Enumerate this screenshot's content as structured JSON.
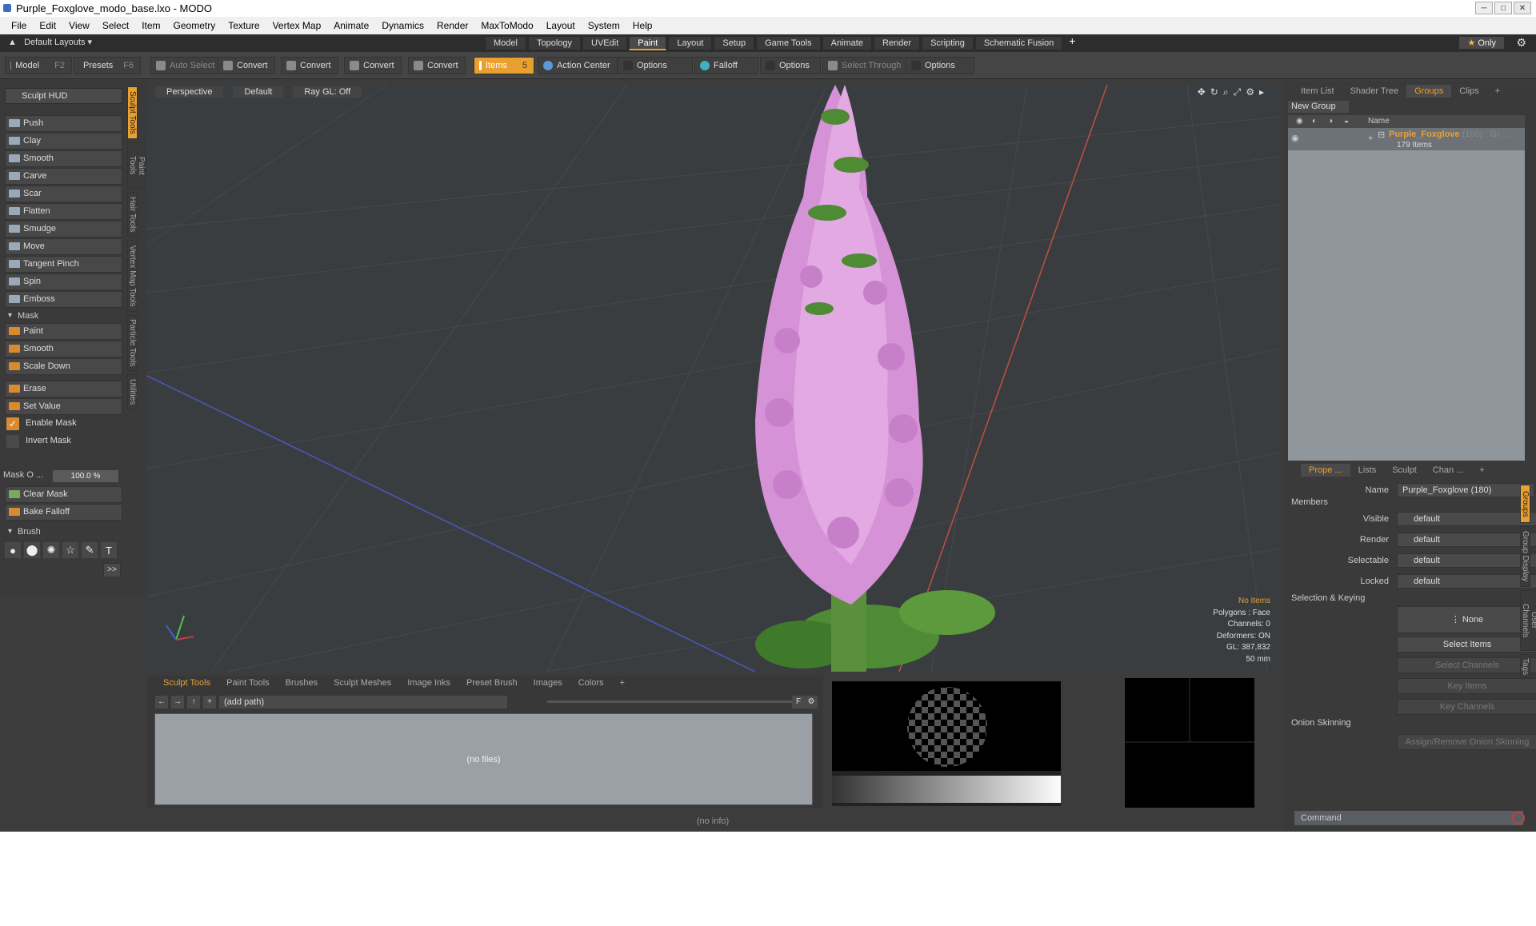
{
  "title": "Purple_Foxglove_modo_base.lxo - MODO",
  "window_buttons": [
    "─",
    "□",
    "✕"
  ],
  "menu": [
    "File",
    "Edit",
    "View",
    "Select",
    "Item",
    "Geometry",
    "Texture",
    "Vertex Map",
    "Animate",
    "Dynamics",
    "Render",
    "MaxToModo",
    "Layout",
    "System",
    "Help"
  ],
  "layout_dropdown": "Default Layouts",
  "layout_tabs": [
    "Model",
    "Topology",
    "UVEdit",
    "Paint",
    "Layout",
    "Setup",
    "Game Tools",
    "Animate",
    "Render",
    "Scripting",
    "Schematic Fusion"
  ],
  "layout_plus": "+",
  "only_label": "Only",
  "toolbar": {
    "model": "Model",
    "model_key": "F2",
    "presets": "Presets",
    "presets_key": "F6",
    "auto_select": "Auto Select",
    "convert1": "Convert",
    "convert2": "Convert",
    "convert3": "Convert",
    "convert4": "Convert",
    "items": "Items",
    "items_key": "5",
    "action_center": "Action Center",
    "options1": "Options",
    "falloff": "Falloff",
    "options2": "Options",
    "select_through": "Select Through",
    "options3": "Options"
  },
  "sculpt": {
    "hud": "Sculpt HUD",
    "tools": [
      "Push",
      "Clay",
      "Smooth",
      "Carve",
      "Scar",
      "Flatten",
      "Smudge",
      "Move",
      "Tangent Pinch",
      "Spin",
      "Emboss"
    ],
    "mask_section": "Mask",
    "mask_tools": [
      "Paint",
      "Smooth",
      "Scale Down"
    ],
    "erase": "Erase",
    "set_value": "Set Value",
    "enable_mask": "Enable Mask",
    "invert_mask": "Invert Mask",
    "mask_opacity_label": "Mask O ...",
    "mask_opacity_value": "100.0 %",
    "clear_mask": "Clear Mask",
    "bake_falloff": "Bake Falloff",
    "brush_section": "Brush",
    "more": ">>"
  },
  "vtabs": [
    "Sculpt Tools",
    "Paint Tools",
    "Hair Tools",
    "Vertex Map Tools",
    "Particle Tools",
    "Utilities"
  ],
  "viewport": {
    "view": "Perspective",
    "style": "Default",
    "raygl": "Ray GL: Off",
    "info": [
      "No Items",
      "Polygons : Face",
      "Channels: 0",
      "Deformers: ON",
      "GL: 387,832",
      "50 mm"
    ]
  },
  "bottom": {
    "tabs": [
      "Sculpt Tools",
      "Paint Tools",
      "Brushes",
      "Sculpt Meshes",
      "Image Inks",
      "Preset Brush",
      "Images",
      "Colors",
      "+"
    ],
    "path": "(add path)",
    "files": "(no files)",
    "f_label": "F"
  },
  "status": "(no info)",
  "right": {
    "tabs": [
      "Item List",
      "Shader Tree",
      "Groups",
      "Clips",
      "+"
    ],
    "new_group": "New Group",
    "col_name": "Name",
    "group_name": "Purple_Foxglove",
    "group_count": "(180) : Gr ...",
    "group_items": "179 Items",
    "prop_tabs": [
      "Prope ...",
      "Lists",
      "Sculpt",
      "Chan ...",
      "+"
    ],
    "name_label": "Name",
    "name_value": "Purple_Foxglove (180)",
    "members": "Members",
    "visible_label": "Visible",
    "visible": "default",
    "render_label": "Render",
    "render": "default",
    "selectable_label": "Selectable",
    "selectable": "default",
    "locked_label": "Locked",
    "locked": "default",
    "sel_keying": "Selection & Keying",
    "none": "None",
    "select_items": "Select Items",
    "select_channels": "Select Channels",
    "key_items": "Key Items",
    "key_channels": "Key Channels",
    "onion": "Onion Skinning",
    "onion_btn": "Assign/Remove Onion Skinning",
    "command": "Command",
    "rvtabs": [
      "Groups",
      "Group Display",
      "User Channels",
      "Tags"
    ]
  }
}
